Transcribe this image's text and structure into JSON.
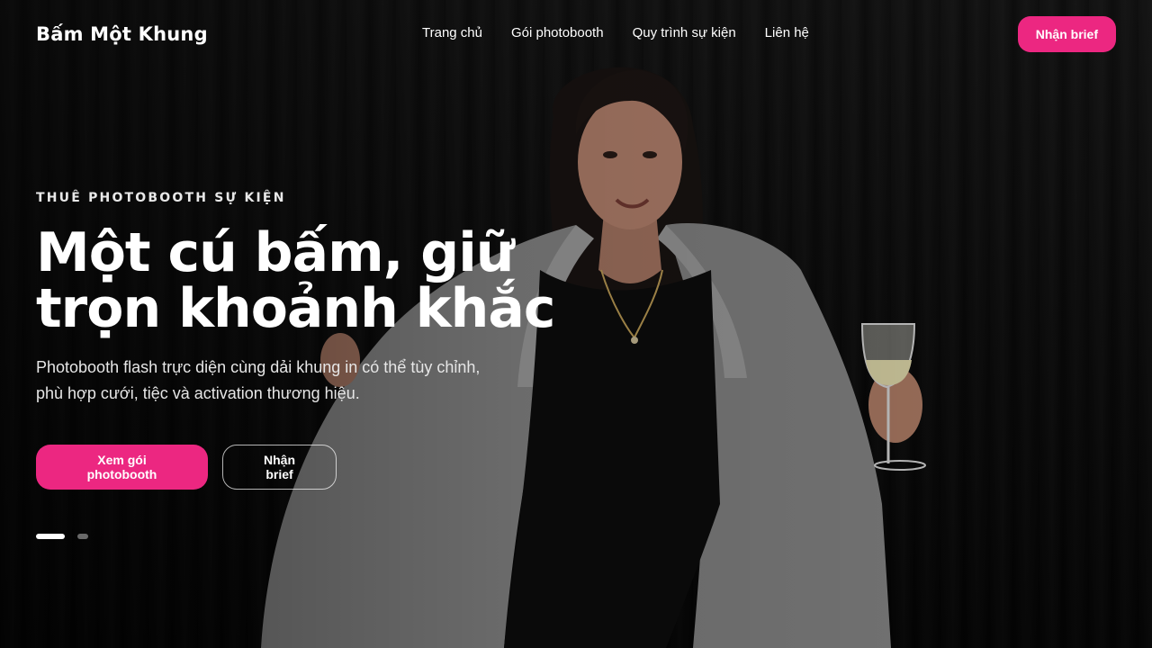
{
  "brand": {
    "name": "Bấm Một Khung"
  },
  "nav": {
    "links": [
      "Trang chủ",
      "Gói photobooth",
      "Quy trình sự kiện",
      "Liên hệ"
    ],
    "cta_label": "Nhận brief"
  },
  "hero": {
    "eyebrow": "THUÊ PHOTOBOOTH SỰ KIỆN",
    "headline_line1": "Một cú bấm, giữ",
    "headline_line2": "trọn khoảnh khắc",
    "subtext_line1": "Photobooth flash trực diện cùng dải khung in có thể tùy chỉnh,",
    "subtext_line2": "phù hợp cưới, tiệc và activation thương hiệu.",
    "primary_button": "Xem gói photobooth",
    "secondary_button": "Nhận brief"
  },
  "slider": {
    "count": 2,
    "active_index": 0
  },
  "colors": {
    "accent": "#ec2781",
    "background": "#0b0b0b",
    "text": "#ffffff"
  }
}
